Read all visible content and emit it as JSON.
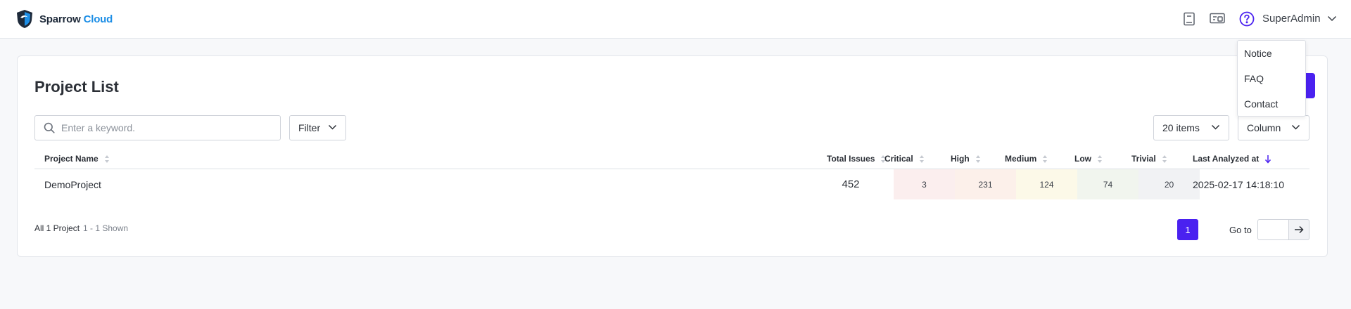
{
  "header": {
    "brand_part1": "Sparrow",
    "brand_part2": "Cloud",
    "icons": [
      "book-icon",
      "monitor-chat-icon",
      "help-circle-icon"
    ],
    "user_name": "SuperAdmin",
    "brand_color": "#1c8ee6",
    "help_icon_color": "#4a21f0"
  },
  "help_menu": {
    "items": [
      "Notice",
      "FAQ",
      "Contact"
    ]
  },
  "main": {
    "title": "Project List",
    "search_placeholder": "Enter a keyword.",
    "filter_label": "Filter",
    "page_size_label": "20 items",
    "column_label": "Column",
    "accent_color": "#4a21f0"
  },
  "table": {
    "columns": [
      "Project Name",
      "Total Issues",
      "Critical",
      "High",
      "Medium",
      "Low",
      "Trivial",
      "Last Analyzed at"
    ],
    "sorted_column": "Last Analyzed at",
    "sort_direction": "descending",
    "rows": [
      {
        "project_name": "DemoProject",
        "total_issues": "452",
        "critical": "3",
        "high": "231",
        "medium": "124",
        "low": "74",
        "trivial": "20",
        "last_analyzed_at": "2025-02-17 14:18:10"
      }
    ],
    "severity_colors": {
      "critical": "#fbeeee",
      "high": "#fcf0ea",
      "medium": "#fcf9e8",
      "low": "#f1f5ee",
      "trivial": "#f1f2f4"
    }
  },
  "footer": {
    "total_text": "All 1 Project",
    "shown_text": "1 - 1 Shown",
    "current_page": "1",
    "goto_label": "Go to",
    "goto_value": ""
  }
}
